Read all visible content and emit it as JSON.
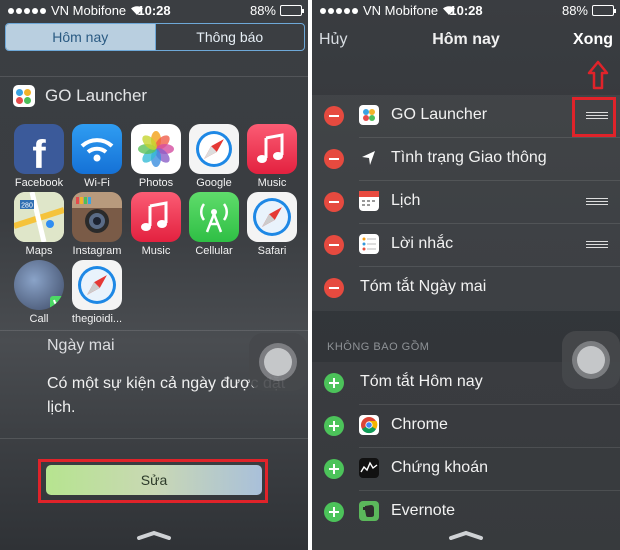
{
  "status_left": {
    "carrier": "VN Mobifone",
    "time": "10:28",
    "battery": "88%",
    "battery_level": 0.88
  },
  "status_right": {
    "carrier": "VN Mobifone",
    "time": "10:28",
    "battery": "88%",
    "battery_level": 0.88
  },
  "segments": {
    "today": "Hôm nay",
    "notifications": "Thông báo",
    "selected": "today"
  },
  "widget": {
    "title": "GO Launcher",
    "apps": [
      {
        "label": "Facebook",
        "icon": "facebook-icon"
      },
      {
        "label": "Wi-Fi",
        "icon": "wifi-icon"
      },
      {
        "label": "Photos",
        "icon": "photos-icon"
      },
      {
        "label": "Google",
        "icon": "google-icon"
      },
      {
        "label": "Music",
        "icon": "music-icon"
      },
      {
        "label": "Maps",
        "icon": "maps-icon"
      },
      {
        "label": "Instagram",
        "icon": "instagram-icon"
      },
      {
        "label": "Music",
        "icon": "music-icon"
      },
      {
        "label": "Cellular",
        "icon": "cellular-icon"
      },
      {
        "label": "Safari",
        "icon": "safari-icon"
      },
      {
        "label": "Call",
        "icon": "call-icon"
      },
      {
        "label": "thegioidi...",
        "icon": "safari-icon"
      }
    ]
  },
  "tomorrow": {
    "title": "Ngày mai",
    "event_text": "Có một sự kiện cả ngày được đặt lịch."
  },
  "edit_button": "Sửa",
  "right_nav": {
    "cancel": "Hủy",
    "title": "Hôm nay",
    "done": "Xong"
  },
  "included": [
    {
      "label": "GO Launcher",
      "icon": "golauncher-icon",
      "reorder": true
    },
    {
      "label": "Tình trạng Giao thông",
      "icon": "location-arrow-icon",
      "reorder": false
    },
    {
      "label": "Lịch",
      "icon": "calendar-icon",
      "reorder": true
    },
    {
      "label": "Lời nhắc",
      "icon": "reminders-icon",
      "reorder": true
    },
    {
      "label": "Tóm tắt Ngày mai",
      "icon": "",
      "reorder": false
    }
  ],
  "excluded_header": "KHÔNG BAO GỒM",
  "excluded": [
    {
      "label": "Tóm tắt Hôm nay",
      "icon": ""
    },
    {
      "label": "Chrome",
      "icon": "chrome-icon"
    },
    {
      "label": "Chứng khoán",
      "icon": "stocks-icon"
    },
    {
      "label": "Evernote",
      "icon": "evernote-icon"
    }
  ],
  "colors": {
    "remove": "#e64a3f",
    "add": "#4cc35a",
    "highlight": "#e0232a",
    "segment_accent": "#6ea8d8"
  }
}
